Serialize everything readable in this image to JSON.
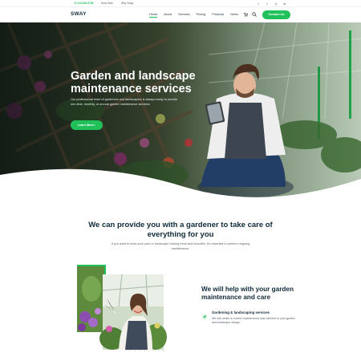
{
  "topbar": {
    "phone": "+1 212-946-2706",
    "link1": "Help Desk",
    "link2": "Why Sway",
    "social": [
      {
        "icon": "facebook-icon",
        "glyph": "f"
      },
      {
        "icon": "twitter-icon",
        "glyph": "t"
      },
      {
        "icon": "instagram-icon",
        "glyph": "◎"
      },
      {
        "icon": "linkedin-icon",
        "glyph": "in"
      }
    ]
  },
  "nav": {
    "logo": "SWAY",
    "items": [
      "Home",
      "About",
      "Services",
      "Pricing",
      "Products",
      "News"
    ],
    "active": "Home",
    "contact_label": "Contact Us"
  },
  "hero": {
    "title": "Garden and landscape maintenance services",
    "subtitle": "Our professional team of gardeners and landscapers is always ready to provide one-time, monthly, or annual garden maintenance services.",
    "button_label": "Learn More"
  },
  "intro": {
    "title": "We can provide you with a gardener to take care of everything for you",
    "subtitle": "If you want to keep your yard or landscape looking fresh and beautiful, it’s essential to perform ongoing maintenance."
  },
  "help": {
    "title": "We will help with your garden maintenance and care",
    "service_title": "Gardening & landscaping services",
    "service_desc": "We will create a custom maintenance plan tailored to your garden and landscape design."
  },
  "colors": {
    "accent": "#20c05a",
    "heading": "#102a3a",
    "body_text": "#5c6670"
  }
}
